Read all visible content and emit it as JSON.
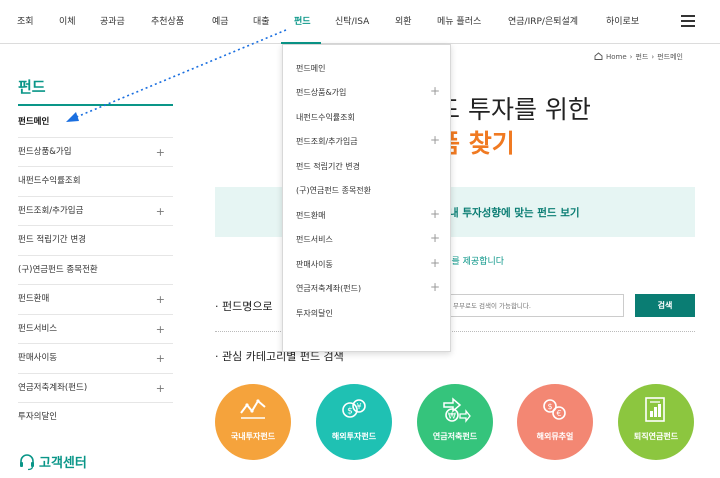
{
  "nav": {
    "items": [
      "조회",
      "이체",
      "공과금",
      "추천상품",
      "예금",
      "대출",
      "펀드",
      "신탁/ISA",
      "외환",
      "메뉴 플러스",
      "연금/IRP/은퇴설계",
      "하이로보"
    ],
    "active": "펀드"
  },
  "sidebar": {
    "title": "펀드",
    "items": [
      {
        "label": "펀드메인",
        "plus": ""
      },
      {
        "label": "펀드상품&가입",
        "plus": "+"
      },
      {
        "label": "내펀드수익률조회",
        "plus": ""
      },
      {
        "label": "펀드조회/추가입금",
        "plus": "+"
      },
      {
        "label": "펀드 적립기간 변경",
        "plus": ""
      },
      {
        "label": "(구)연금펀드 종목전환",
        "plus": ""
      },
      {
        "label": "펀드환매",
        "plus": "+"
      },
      {
        "label": "펀드서비스",
        "plus": "+"
      },
      {
        "label": "판매사이동",
        "plus": "+"
      },
      {
        "label": "연금저축계좌(펀드)",
        "plus": "+"
      },
      {
        "label": "투자의달인",
        "plus": ""
      }
    ],
    "customer_center": "고객센터"
  },
  "dropdown": {
    "items": [
      {
        "label": "펀드메인",
        "plus": ""
      },
      {
        "label": "펀드상품&가입",
        "plus": "+"
      },
      {
        "label": "내펀드수익률조회",
        "plus": ""
      },
      {
        "label": "펀드조회/추가입금",
        "plus": "+"
      },
      {
        "label": "펀드 적립기간 변경",
        "plus": ""
      },
      {
        "label": "(구)연금펀드 종목전환",
        "plus": ""
      },
      {
        "label": "펀드환매",
        "plus": "+"
      },
      {
        "label": "펀드서비스",
        "plus": "+"
      },
      {
        "label": "판매사이동",
        "plus": "+"
      },
      {
        "label": "연금저축계좌(펀드)",
        "plus": "+"
      },
      {
        "label": "투자의달인",
        "plus": ""
      }
    ]
  },
  "breadcrumb": {
    "home": "Home",
    "level1": "펀드",
    "level2": "펀드메인"
  },
  "hero": {
    "line1": "드 투자를 위한",
    "line2": "품 찾기"
  },
  "banner": {
    "text": "내 투자성향에 맞는 펀드 보기"
  },
  "subtext": "l를 제공합니다",
  "search": {
    "title": "· 펀드명으로",
    "placeholder": "무부로도 검색이 가능합니다.",
    "button": "검색"
  },
  "category": {
    "title": "· 관심 카테고리별 펀드 검색",
    "items": [
      {
        "label": "국내투자펀드",
        "color": "#f5a33c",
        "icon": "chart-line-icon"
      },
      {
        "label": "해외투자펀드",
        "color": "#1fc1b3",
        "icon": "currency-exchange-icon"
      },
      {
        "label": "연금저축펀드",
        "color": "#35c47c",
        "icon": "money-arrow-icon"
      },
      {
        "label": "해외뮤추얼",
        "color": "#f38773",
        "icon": "coin-exchange-icon"
      },
      {
        "label": "퇴직연금펀드",
        "color": "#8cc63f",
        "icon": "document-chart-icon"
      }
    ]
  }
}
